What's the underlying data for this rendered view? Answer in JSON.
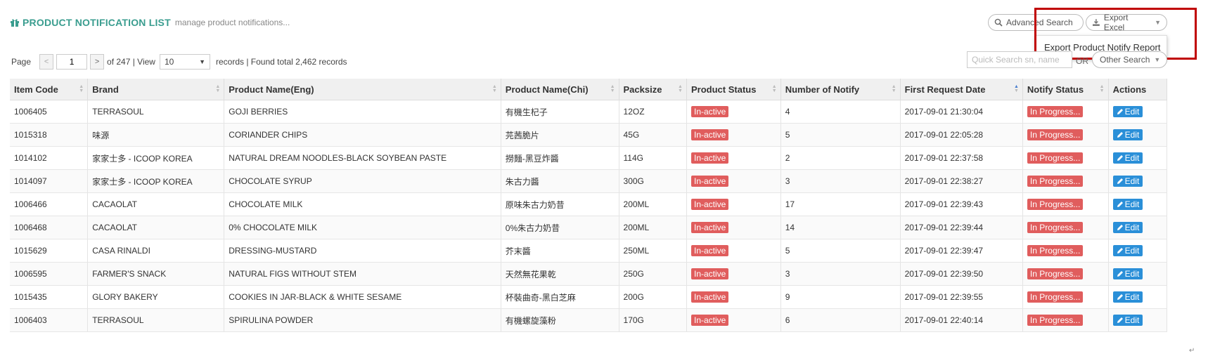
{
  "header": {
    "title": "PRODUCT NOTIFICATION LIST",
    "subtitle": "manage product notifications...",
    "advanced_search_label": "Advanced Search",
    "export_excel_label": "Export Excel",
    "export_menu_item": "Export Product Notify Report"
  },
  "pager": {
    "page_label": "Page",
    "prev_label": "<",
    "current_page": "1",
    "next_label": ">",
    "of_text": "of 247 | View",
    "view_value": "10",
    "records_text": "records | Found total 2,462 records"
  },
  "search": {
    "quick_placeholder": "Quick Search sn, name",
    "or_text": "OR",
    "other_label": "Other Search"
  },
  "columns": [
    "Item Code",
    "Brand",
    "Product Name(Eng)",
    "Product Name(Chi)",
    "Packsize",
    "Product Status",
    "Number of Notify",
    "First Request Date",
    "Notify Status",
    "Actions"
  ],
  "rows": [
    {
      "item_code": "1006405",
      "brand": "TERRASOUL",
      "name_eng": "GOJI BERRIES",
      "name_chi": "有機生杞子",
      "packsize": "12OZ",
      "product_status": "In-active",
      "notify_count": "4",
      "first_request": "2017-09-01 21:30:04",
      "notify_status": "In Progress...",
      "action": "Edit"
    },
    {
      "item_code": "1015318",
      "brand": "味源",
      "name_eng": "CORIANDER CHIPS",
      "name_chi": "芫茜脆片",
      "packsize": "45G",
      "product_status": "In-active",
      "notify_count": "5",
      "first_request": "2017-09-01 22:05:28",
      "notify_status": "In Progress...",
      "action": "Edit"
    },
    {
      "item_code": "1014102",
      "brand": "家家士多 - ICOOP KOREA",
      "name_eng": "NATURAL DREAM NOODLES-BLACK SOYBEAN PASTE",
      "name_chi": "撈麵-黑豆炸醬",
      "packsize": "114G",
      "product_status": "In-active",
      "notify_count": "2",
      "first_request": "2017-09-01 22:37:58",
      "notify_status": "In Progress...",
      "action": "Edit"
    },
    {
      "item_code": "1014097",
      "brand": "家家士多 - ICOOP KOREA",
      "name_eng": "CHOCOLATE SYRUP",
      "name_chi": "朱古力醬",
      "packsize": "300G",
      "product_status": "In-active",
      "notify_count": "3",
      "first_request": "2017-09-01 22:38:27",
      "notify_status": "In Progress...",
      "action": "Edit"
    },
    {
      "item_code": "1006466",
      "brand": "CACAOLAT",
      "name_eng": "CHOCOLATE MILK",
      "name_chi": "原味朱古力奶昔",
      "packsize": "200ML",
      "product_status": "In-active",
      "notify_count": "17",
      "first_request": "2017-09-01 22:39:43",
      "notify_status": "In Progress...",
      "action": "Edit"
    },
    {
      "item_code": "1006468",
      "brand": "CACAOLAT",
      "name_eng": "0% CHOCOLATE MILK",
      "name_chi": "0%朱古力奶昔",
      "packsize": "200ML",
      "product_status": "In-active",
      "notify_count": "14",
      "first_request": "2017-09-01 22:39:44",
      "notify_status": "In Progress...",
      "action": "Edit"
    },
    {
      "item_code": "1015629",
      "brand": "CASA RINALDI",
      "name_eng": "DRESSING-MUSTARD",
      "name_chi": "芥末醬",
      "packsize": "250ML",
      "product_status": "In-active",
      "notify_count": "5",
      "first_request": "2017-09-01 22:39:47",
      "notify_status": "In Progress...",
      "action": "Edit"
    },
    {
      "item_code": "1006595",
      "brand": "FARMER'S SNACK",
      "name_eng": "NATURAL FIGS WITHOUT STEM",
      "name_chi": "天然無花果乾",
      "packsize": "250G",
      "product_status": "In-active",
      "notify_count": "3",
      "first_request": "2017-09-01 22:39:50",
      "notify_status": "In Progress...",
      "action": "Edit"
    },
    {
      "item_code": "1015435",
      "brand": "GLORY BAKERY",
      "name_eng": "COOKIES IN JAR-BLACK & WHITE SESAME",
      "name_chi": "杯裝曲奇-黑白芝麻",
      "packsize": "200G",
      "product_status": "In-active",
      "notify_count": "9",
      "first_request": "2017-09-01 22:39:55",
      "notify_status": "In Progress...",
      "action": "Edit"
    },
    {
      "item_code": "1006403",
      "brand": "TERRASOUL",
      "name_eng": "SPIRULINA POWDER",
      "name_chi": "有機螺旋藻粉",
      "packsize": "170G",
      "product_status": "In-active",
      "notify_count": "6",
      "first_request": "2017-09-01 22:40:14",
      "notify_status": "In Progress...",
      "action": "Edit"
    }
  ],
  "colors": {
    "title": "#3a9d8f",
    "status_red": "#e05d5d",
    "edit_blue": "#2a8fd8",
    "highlight": "#c00000"
  }
}
